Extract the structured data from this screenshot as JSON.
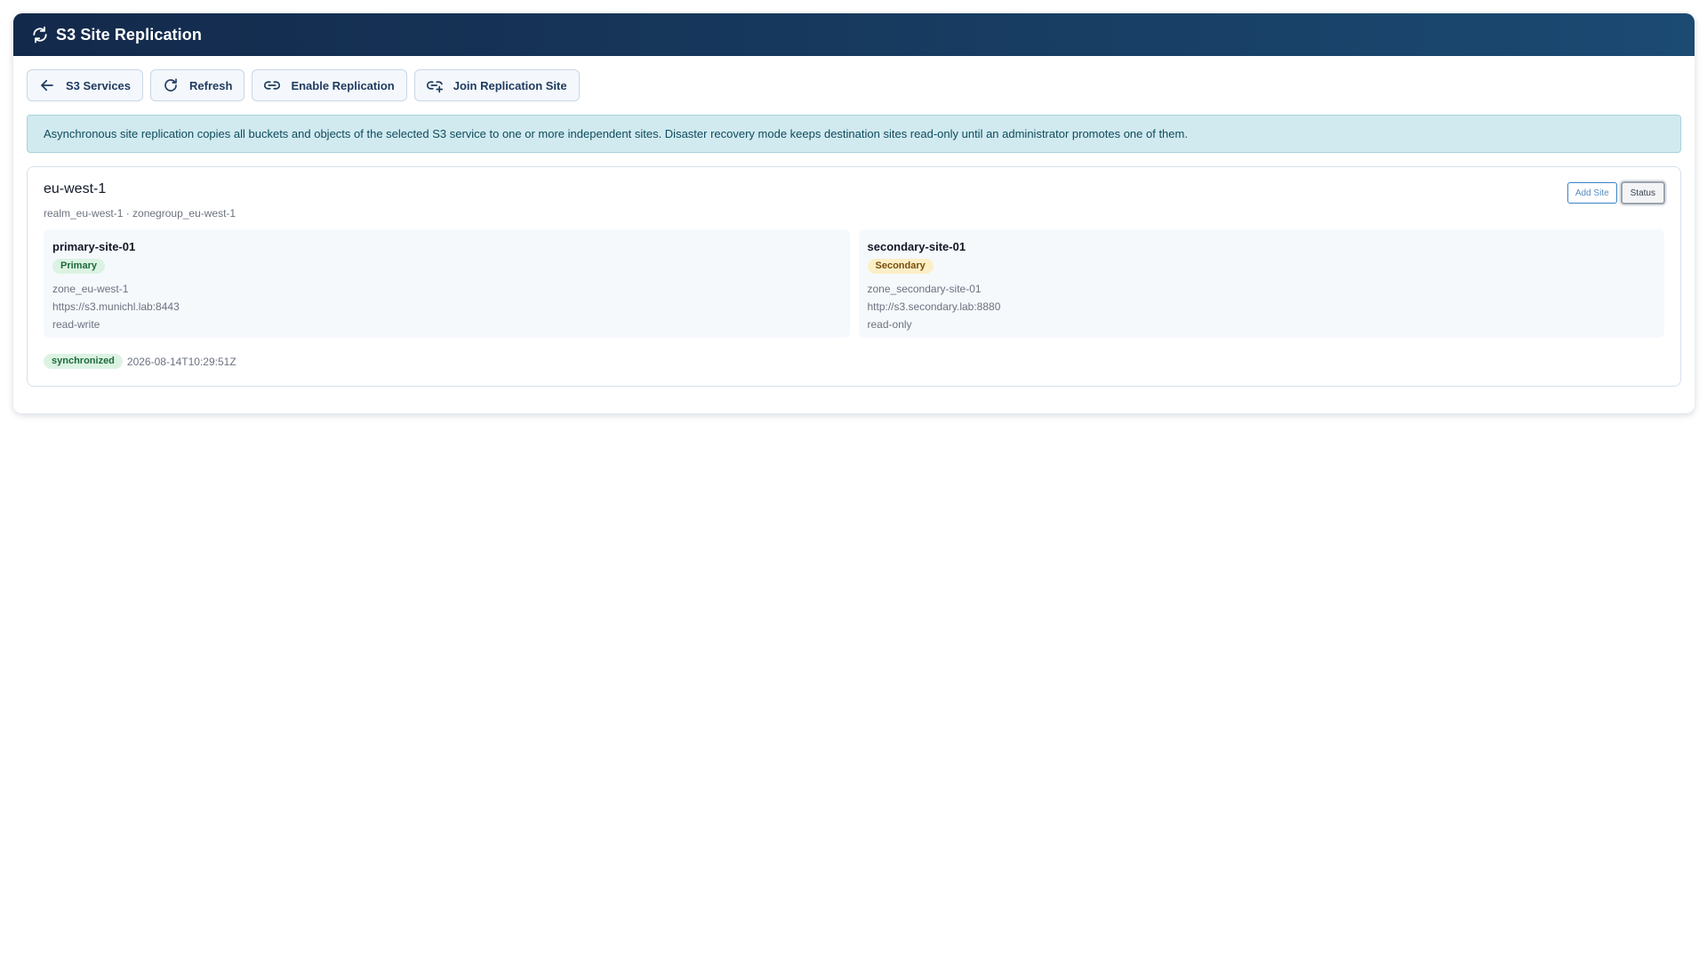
{
  "window": {
    "title": "S3 Site Replication",
    "title_icon": "sync-icon"
  },
  "toolbar": {
    "buttons": [
      {
        "label": "S3 Services",
        "icon": "arrow-left-icon"
      },
      {
        "label": "Refresh",
        "icon": "refresh-icon"
      },
      {
        "label": "Enable Replication",
        "icon": "link-icon"
      },
      {
        "label": "Join Replication Site",
        "icon": "link-add-icon"
      }
    ]
  },
  "info": {
    "text": "Asynchronous site replication copies all buckets and objects of the selected S3 service to one or more independent sites. Disaster recovery mode keeps destination sites read-only until an administrator promotes one of them."
  },
  "zonegroup": {
    "name": "eu-west-1",
    "meta": "realm_eu-west-1 · zonegroup_eu-west-1",
    "add_site_label": "Add Site",
    "status_label": "Status",
    "sites": [
      {
        "name": "primary-site-01",
        "role": "Primary",
        "zone": "zone_eu-west-1",
        "endpoint": "https://s3.munichl.lab:8443",
        "mode": "read-write"
      },
      {
        "name": "secondary-site-01",
        "role": "Secondary",
        "zone": "zone_secondary-site-01",
        "endpoint": "http://s3.secondary.lab:8880",
        "mode": "read-only"
      }
    ],
    "sync_status": "synchronized",
    "sync_time": "2026-08-14T10:29:51Z"
  },
  "colors": {
    "header_start": "#13294b",
    "header_end": "#1b4a72",
    "info_bg": "#d1eaf0",
    "primary_badge_bg": "#dcf3e3",
    "secondary_badge_bg": "#fcefc7"
  }
}
